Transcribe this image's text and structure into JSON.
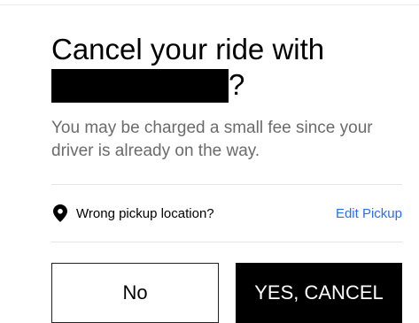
{
  "dialog": {
    "title_line1": "Cancel your ride with",
    "title_suffix": "?",
    "subtitle": "You may be charged a small fee since your driver is already on the way.",
    "reason": {
      "icon": "location-pin-icon",
      "label": "Wrong pickup location?",
      "action_label": "Edit Pickup"
    },
    "buttons": {
      "no_label": "No",
      "yes_label": "YES, CANCEL"
    }
  },
  "colors": {
    "text_primary": "#000000",
    "text_secondary": "#6b6b6b",
    "link": "#276ef1",
    "primary_button_bg": "#000000",
    "divider": "#e4e4e4"
  }
}
